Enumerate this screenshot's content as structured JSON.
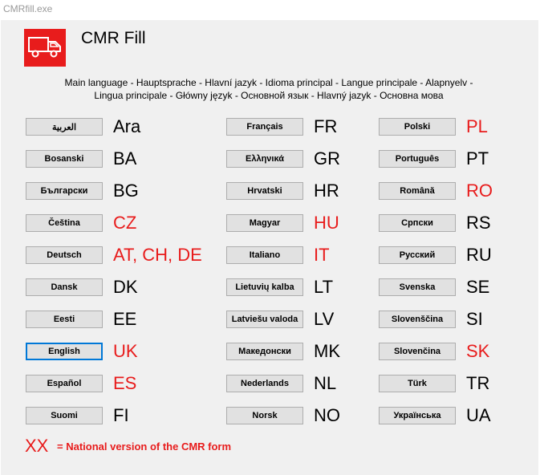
{
  "window": {
    "title": "CMRfill.exe"
  },
  "app": {
    "title": "CMR Fill",
    "logo": "truck-icon"
  },
  "description": {
    "line1": "Main language - Hauptsprache - Hlavní jazyk - Idioma principal - Langue principale - Alapnyelv -",
    "line2": "Lingua principale - Główny język - Основной язык - Hlavný jazyk - Основна мова"
  },
  "colors": {
    "national": "#e81c1c",
    "plain": "#000000",
    "focus": "#0078d7"
  },
  "columns": [
    {
      "languages": [
        {
          "label": "العربية",
          "code": "Ara",
          "national": false
        },
        {
          "label": "Bosanski",
          "code": "BA",
          "national": false
        },
        {
          "label": "Български",
          "code": "BG",
          "national": false
        },
        {
          "label": "Čeština",
          "code": "CZ",
          "national": true
        },
        {
          "label": "Deutsch",
          "code": "AT, CH, DE",
          "national": true
        },
        {
          "label": "Dansk",
          "code": "DK",
          "national": false
        },
        {
          "label": "Eesti",
          "code": "EE",
          "national": false
        },
        {
          "label": "English",
          "code": "UK",
          "national": true,
          "focused": true
        },
        {
          "label": "Español",
          "code": "ES",
          "national": true
        },
        {
          "label": "Suomi",
          "code": "FI",
          "national": false
        }
      ]
    },
    {
      "languages": [
        {
          "label": "Français",
          "code": "FR",
          "national": false
        },
        {
          "label": "Ελληνικά",
          "code": "GR",
          "national": false
        },
        {
          "label": "Hrvatski",
          "code": "HR",
          "national": false
        },
        {
          "label": "Magyar",
          "code": "HU",
          "national": true
        },
        {
          "label": "Italiano",
          "code": "IT",
          "national": true
        },
        {
          "label": "Lietuvių kalba",
          "code": "LT",
          "national": false
        },
        {
          "label": "Latviešu valoda",
          "code": "LV",
          "national": false
        },
        {
          "label": "Македонски",
          "code": "MK",
          "national": false
        },
        {
          "label": "Nederlands",
          "code": "NL",
          "national": false
        },
        {
          "label": "Norsk",
          "code": "NO",
          "national": false
        }
      ]
    },
    {
      "languages": [
        {
          "label": "Polski",
          "code": "PL",
          "national": true
        },
        {
          "label": "Português",
          "code": "PT",
          "national": false
        },
        {
          "label": "Română",
          "code": "RO",
          "national": true
        },
        {
          "label": "Српски",
          "code": "RS",
          "national": false
        },
        {
          "label": "Русский",
          "code": "RU",
          "national": false
        },
        {
          "label": "Svenska",
          "code": "SE",
          "national": false
        },
        {
          "label": "Slovenščina",
          "code": "SI",
          "national": false
        },
        {
          "label": "Slovenčina",
          "code": "SK",
          "national": true
        },
        {
          "label": "Türk",
          "code": "TR",
          "national": false
        },
        {
          "label": "Українська",
          "code": "UA",
          "national": false
        }
      ]
    }
  ],
  "legend": {
    "sample": "XX",
    "text": "= National version of the CMR form"
  }
}
